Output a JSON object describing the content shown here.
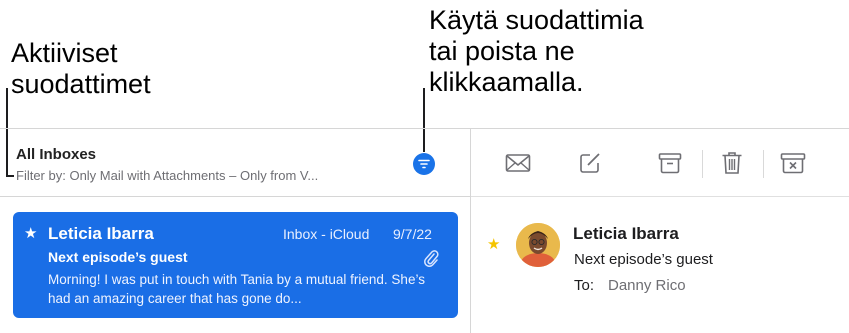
{
  "callouts": {
    "active_filters": "Aktiiviset\nsuodattimet",
    "apply_filters": "Käytä suodattimia\ntai poista ne\nklikkaamalla."
  },
  "mailbox": {
    "title": "All Inboxes",
    "filter_text": "Filter by: Only Mail with Attachments – Only from V..."
  },
  "toolbar": {
    "icons": [
      "envelope-icon",
      "compose-icon",
      "archive-icon",
      "trash-icon",
      "junk-icon"
    ]
  },
  "message_list": [
    {
      "sender": "Leticia Ibarra",
      "mailbox": "Inbox - iCloud",
      "date": "9/7/22",
      "subject": "Next episode’s guest",
      "preview": "Morning! I was put in touch with Tania by a mutual friend. She’s had an amazing career that has gone do...",
      "flagged": true,
      "has_attachment": true,
      "selected": true
    }
  ],
  "viewer": {
    "sender": "Leticia Ibarra",
    "subject": "Next episode’s guest",
    "to_label": "To:",
    "to_value": "Danny Rico"
  },
  "colors": {
    "accent": "#1a6ee6",
    "flag_star": "#f5c400"
  }
}
